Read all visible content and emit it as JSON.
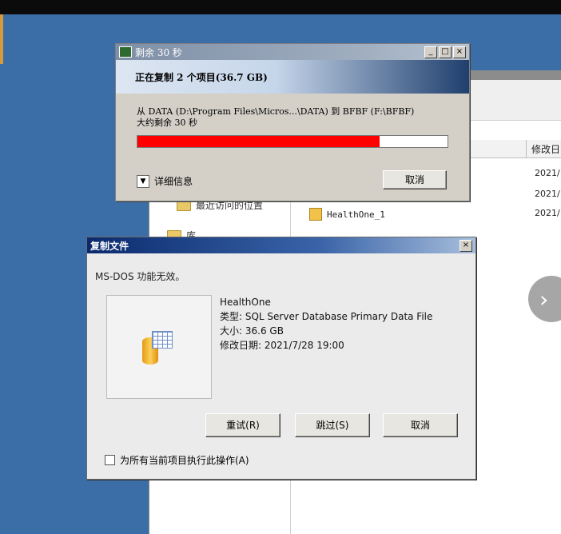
{
  "explorer": {
    "column_header_modified": "修改日",
    "file_name": "HealthOne_1",
    "dates": [
      "2021/",
      "2021/",
      "2021/"
    ],
    "nav_recent_places": "最近访问的位置",
    "nav_libraries": "库"
  },
  "progress_dialog": {
    "title": "剩余 30 秒",
    "banner": "正在复制 2 个项目(36.7 GB)",
    "from_line": "从 DATA (D:\\Program Files\\Micros...\\DATA) 到 BFBF (F:\\BFBF)",
    "remaining": "大约剩余 30 秒",
    "progress_fraction": 0.78,
    "details_label": "详细信息",
    "cancel_label": "取消",
    "progress_color": "#ff0000"
  },
  "copy_dialog": {
    "title": "复制文件",
    "message": "MS-DOS 功能无效。",
    "file": {
      "name": "HealthOne",
      "type": "类型: SQL Server Database Primary Data File",
      "size": "大小: 36.6 GB",
      "modified": "修改日期: 2021/7/28 19:00"
    },
    "retry_label": "重试(R)",
    "skip_label": "跳过(S)",
    "cancel_label": "取消",
    "apply_all_label": "为所有当前项目执行此操作(A)"
  },
  "carousel": {
    "next_icon": "chevron-right-icon"
  }
}
